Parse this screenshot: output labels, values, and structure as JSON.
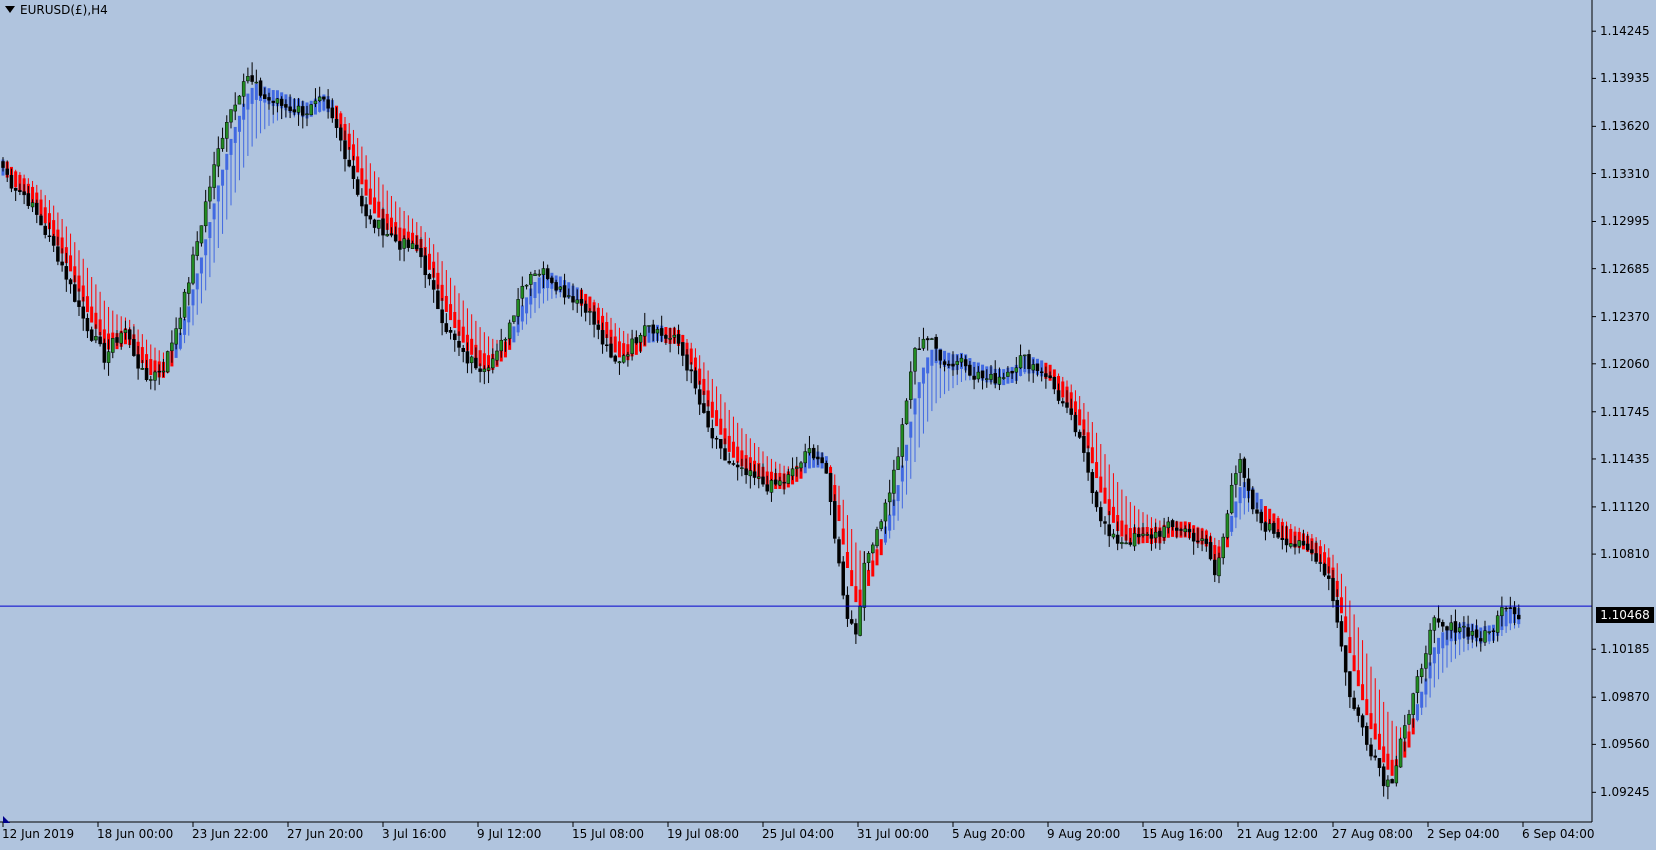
{
  "chart_data": {
    "type": "candlestick",
    "symbol_title": "EURUSD(£),H4",
    "colors": {
      "background": "#b0c4de",
      "bull_candle": "#228b22",
      "bear_candle": "#000000",
      "wick": "#000000",
      "ribbon_down": "#ff0000",
      "ribbon_up": "#4169e1",
      "current_price_line": "#0000cd"
    },
    "y_axis": {
      "ylim": [
        1.0905,
        1.1445
      ],
      "ticks": [
        "1.14245",
        "1.13935",
        "1.13620",
        "1.13310",
        "1.12995",
        "1.12685",
        "1.12370",
        "1.12060",
        "1.11745",
        "1.11435",
        "1.11120",
        "1.10810",
        "1.10468",
        "1.10185",
        "1.09870",
        "1.09560",
        "1.09245"
      ],
      "tick_values": [
        1.14245,
        1.13935,
        1.1362,
        1.1331,
        1.12995,
        1.12685,
        1.1237,
        1.1206,
        1.11745,
        1.11435,
        1.1112,
        1.1081,
        1.10185,
        1.0987,
        1.0956,
        1.09245
      ]
    },
    "x_axis": {
      "ticks": [
        "12 Jun 2019",
        "18 Jun 00:00",
        "23 Jun 22:00",
        "27 Jun 20:00",
        "3 Jul 16:00",
        "9 Jul 12:00",
        "15 Jul 08:00",
        "19 Jul 08:00",
        "25 Jul 04:00",
        "31 Jul 00:00",
        "5 Aug 20:00",
        "9 Aug 20:00",
        "15 Aug 16:00",
        "21 Aug 12:00",
        "27 Aug 08:00",
        "2 Sep 04:00",
        "6 Sep 04:00"
      ],
      "bars_total": 360,
      "bars_per_tick": 22.5
    },
    "current_price": "1.10468",
    "current_price_value": 1.10468,
    "price_path": [
      [
        0,
        1.1335
      ],
      [
        4,
        1.1325
      ],
      [
        12,
        1.1315
      ],
      [
        20,
        1.1295
      ],
      [
        28,
        1.1275
      ],
      [
        40,
        1.1235
      ],
      [
        50,
        1.121
      ],
      [
        60,
        1.123
      ],
      [
        70,
        1.1195
      ],
      [
        80,
        1.1205
      ],
      [
        90,
        1.125
      ],
      [
        100,
        1.131
      ],
      [
        110,
        1.1365
      ],
      [
        120,
        1.1395
      ],
      [
        130,
        1.138
      ],
      [
        140,
        1.1375
      ],
      [
        150,
        1.1372
      ],
      [
        158,
        1.1378
      ],
      [
        165,
        1.136
      ],
      [
        172,
        1.1335
      ],
      [
        180,
        1.13
      ],
      [
        188,
        1.1295
      ],
      [
        196,
        1.1285
      ],
      [
        206,
        1.128
      ],
      [
        212,
        1.1255
      ],
      [
        220,
        1.1228
      ],
      [
        228,
        1.121
      ],
      [
        236,
        1.1205
      ],
      [
        244,
        1.121
      ],
      [
        250,
        1.123
      ],
      [
        256,
        1.1255
      ],
      [
        262,
        1.1268
      ],
      [
        270,
        1.1265
      ],
      [
        276,
        1.1255
      ],
      [
        282,
        1.125
      ],
      [
        288,
        1.1245
      ],
      [
        294,
        1.1228
      ],
      [
        302,
        1.1205
      ],
      [
        312,
        1.122
      ],
      [
        318,
        1.1235
      ],
      [
        326,
        1.1225
      ],
      [
        334,
        1.122
      ],
      [
        340,
        1.12
      ],
      [
        348,
        1.1165
      ],
      [
        356,
        1.1145
      ],
      [
        364,
        1.1135
      ],
      [
        372,
        1.113
      ],
      [
        380,
        1.1125
      ],
      [
        388,
        1.113
      ],
      [
        394,
        1.114
      ],
      [
        400,
        1.115
      ],
      [
        406,
        1.114
      ],
      [
        410,
        1.111
      ],
      [
        414,
        1.107
      ],
      [
        418,
        1.104
      ],
      [
        422,
        1.103
      ],
      [
        426,
        1.107
      ],
      [
        430,
        1.109
      ],
      [
        436,
        1.111
      ],
      [
        442,
        1.114
      ],
      [
        446,
        1.117
      ],
      [
        450,
        1.121
      ],
      [
        456,
        1.1225
      ],
      [
        462,
        1.1215
      ],
      [
        468,
        1.1205
      ],
      [
        474,
        1.121
      ],
      [
        480,
        1.12
      ],
      [
        488,
        1.1195
      ],
      [
        496,
        1.12
      ],
      [
        504,
        1.121
      ],
      [
        510,
        1.1205
      ],
      [
        516,
        1.12
      ],
      [
        522,
        1.1185
      ],
      [
        530,
        1.1165
      ],
      [
        536,
        1.114
      ],
      [
        542,
        1.111
      ],
      [
        548,
        1.109
      ],
      [
        556,
        1.109
      ],
      [
        566,
        1.1092
      ],
      [
        576,
        1.1098
      ],
      [
        584,
        1.1098
      ],
      [
        590,
        1.1092
      ],
      [
        596,
        1.1085
      ],
      [
        600,
        1.1065
      ],
      [
        604,
        1.1095
      ],
      [
        608,
        1.113
      ],
      [
        612,
        1.114
      ],
      [
        616,
        1.112
      ],
      [
        620,
        1.1105
      ],
      [
        626,
        1.1098
      ],
      [
        634,
        1.1092
      ],
      [
        642,
        1.1085
      ],
      [
        650,
        1.108
      ],
      [
        656,
        1.1065
      ],
      [
        660,
        1.104
      ],
      [
        664,
        1.1005
      ],
      [
        668,
        1.098
      ],
      [
        672,
        1.097
      ],
      [
        676,
        1.0955
      ],
      [
        680,
        1.0945
      ],
      [
        684,
        1.093
      ],
      [
        688,
        1.0935
      ],
      [
        692,
        1.0965
      ],
      [
        696,
        1.0975
      ],
      [
        700,
        1.0998
      ],
      [
        704,
        1.102
      ],
      [
        708,
        1.1035
      ],
      [
        714,
        1.103
      ],
      [
        720,
        1.1035
      ],
      [
        726,
        1.103
      ],
      [
        732,
        1.1025
      ],
      [
        736,
        1.103
      ],
      [
        740,
        1.104
      ],
      [
        744,
        1.105
      ],
      [
        748,
        1.1045
      ],
      [
        750,
        1.104
      ]
    ],
    "title": "",
    "xlabel": "",
    "ylabel": "",
    "grid": false
  }
}
